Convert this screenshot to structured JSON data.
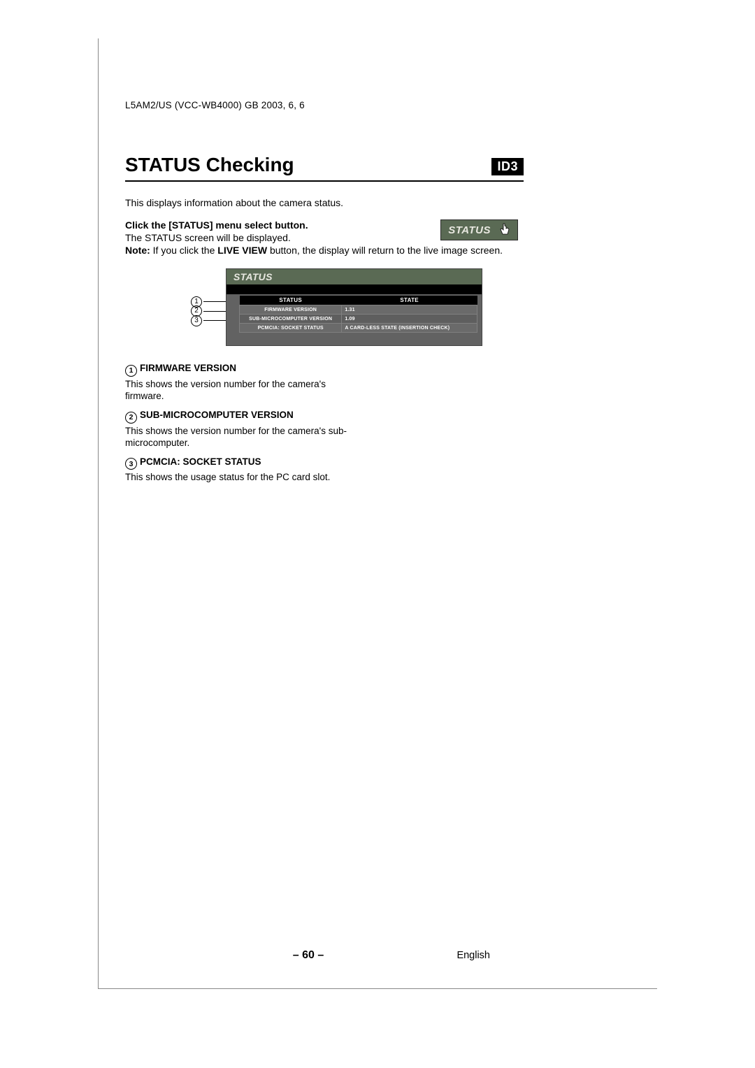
{
  "header": "L5AM2/US (VCC-WB4000)   GB   2003, 6, 6",
  "title": "STATUS Checking",
  "id_badge": "ID3",
  "intro": "This displays information about the camera status.",
  "step": {
    "bold": "Click the [STATUS] menu select button.",
    "sub": "The STATUS screen will be displayed."
  },
  "note_prefix": "Note:",
  "note_mid1": "  If you click the ",
  "note_bold": "LIVE VIEW",
  "note_mid2": " button, the display will return to the live image screen.",
  "status_button_label": "STATUS",
  "panel": {
    "title": "STATUS",
    "col1": "STATUS",
    "col2": "STATE",
    "rows": [
      {
        "label": "FIRMWARE VERSION",
        "value": "1.31"
      },
      {
        "label": "SUB-MICROCOMPUTER VERSION",
        "value": "1.09"
      },
      {
        "label": "PCMCIA: SOCKET STATUS",
        "value": "A CARD-LESS STATE (INSERTION CHECK)"
      }
    ]
  },
  "callout_nums": [
    "1",
    "2",
    "3"
  ],
  "defs": [
    {
      "num": "1",
      "title": "FIRMWARE VERSION",
      "body": "This shows the version number for the camera's firmware."
    },
    {
      "num": "2",
      "title": "SUB-MICROCOMPUTER VERSION",
      "body": "This shows the version number for the camera's sub-microcomputer."
    },
    {
      "num": "3",
      "title": "PCMCIA: SOCKET STATUS",
      "body": "This shows the usage status for the PC card slot."
    }
  ],
  "page_num": "– 60 –",
  "language": "English"
}
